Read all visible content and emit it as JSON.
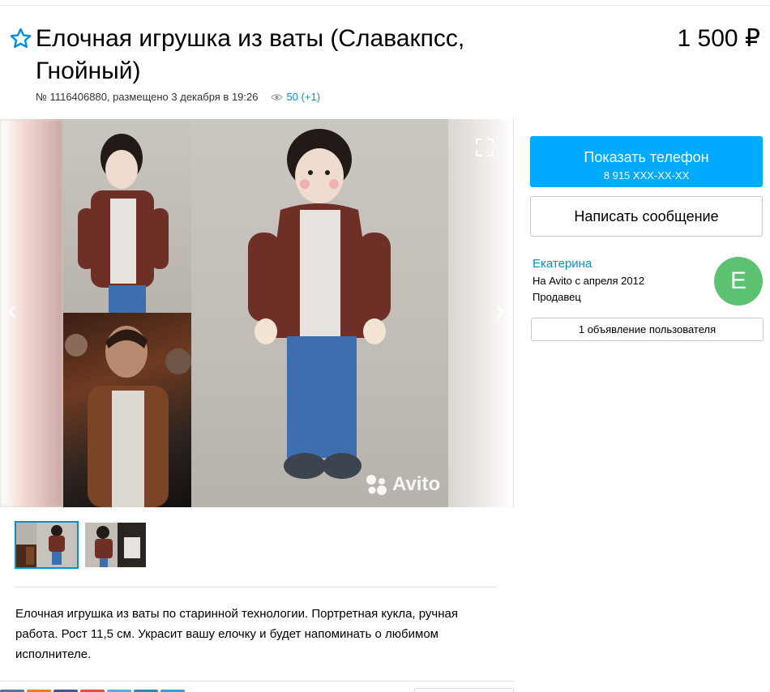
{
  "listing": {
    "title": "Елочная игрушка из ваты (Славакпсс, Гнойный)",
    "price": "1 500 ₽",
    "meta_text": "№ 1116406880, размещено 3 декабря в 19:26",
    "views": "50 (+1)",
    "description": "Елочная игрушка из ваты по старинной технологии. Портретная кукла, ручная работа. Рост 11,5 см. Украсит вашу елочку и будет напоминать о любимом исполнителе."
  },
  "gallery": {
    "watermark": "Avito",
    "thumbnails": [
      "thumb-1",
      "thumb-2"
    ],
    "active_thumbnail": 1
  },
  "contact": {
    "show_phone_label": "Показать телефон",
    "phone_masked": "8 915 XXX-XX-XX",
    "message_label": "Написать сообщение"
  },
  "seller": {
    "name": "Екатерина",
    "since": "На Avito с апреля 2012",
    "role": "Продавец",
    "avatar_letter": "E",
    "ads_label": "1 объявление пользователя"
  },
  "colors": {
    "accent": "#00aaff",
    "link": "#0091d9",
    "avatar": "#5cc170"
  },
  "icons": [
    "star-icon",
    "eye-icon",
    "chevron-left-icon",
    "chevron-right-icon",
    "fullscreen-icon",
    "avito-logo-icon"
  ]
}
